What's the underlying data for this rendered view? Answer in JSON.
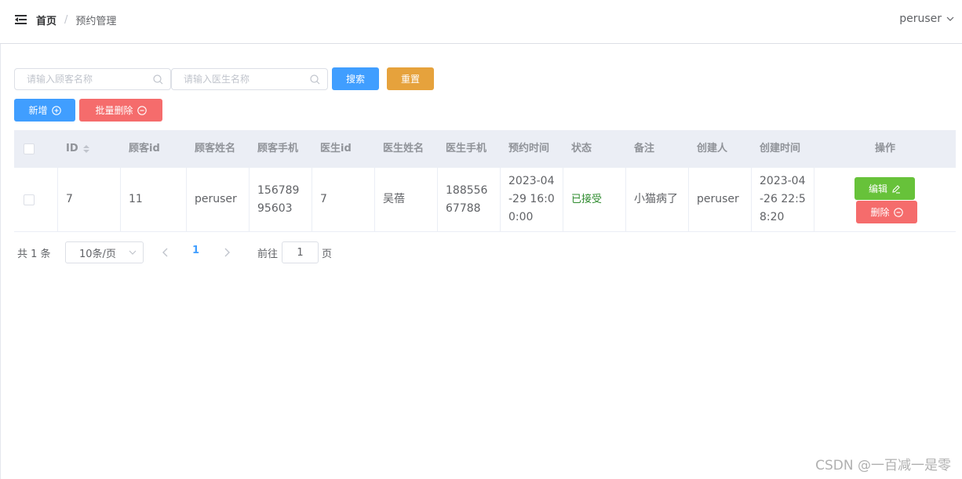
{
  "breadcrumb": {
    "home": "首页",
    "separator": "/",
    "current": "预约管理"
  },
  "user": {
    "name": "peruser"
  },
  "search": {
    "customer_placeholder": "请输入顾客名称",
    "doctor_placeholder": "请输入医生名称",
    "search_label": "搜索",
    "reset_label": "重置"
  },
  "actions": {
    "add_label": "新增",
    "batch_delete_label": "批量删除"
  },
  "table": {
    "headers": [
      "ID",
      "顾客id",
      "顾客姓名",
      "顾客手机",
      "医生id",
      "医生姓名",
      "医生手机",
      "预约时间",
      "状态",
      "备注",
      "创建人",
      "创建时间",
      "操作"
    ],
    "rows": [
      {
        "id": "7",
        "customer_id": "11",
        "customer_name": "peruser",
        "customer_phone": "15678995603",
        "doctor_id": "7",
        "doctor_name": "吴蓓",
        "doctor_phone": "18855667788",
        "appointment_time": "2023-04-29 16:00:00",
        "status": "已接受",
        "remark": "小猫病了",
        "creator": "peruser",
        "created_time": "2023-04-26 22:58:20",
        "edit_label": "编辑",
        "delete_label": "删除"
      }
    ]
  },
  "pagination": {
    "total_text": "共 1 条",
    "page_size": "10条/页",
    "current_page": "1",
    "goto_label": "前往",
    "goto_value": "1",
    "page_suffix": "页"
  },
  "watermark": "CSDN @一百减一是零",
  "colors": {
    "primary": "#409eff",
    "warning": "#e6a23c",
    "danger": "#f56c6c",
    "success": "#67c23a",
    "status_accepted": "#2e8b2e"
  },
  "icons": [
    "menu-fold-icon",
    "chevron-down-icon",
    "search-icon",
    "circle-plus-icon",
    "circle-minus-icon",
    "sort-caret-icon",
    "edit-icon",
    "chevron-left-icon",
    "chevron-right-icon"
  ]
}
